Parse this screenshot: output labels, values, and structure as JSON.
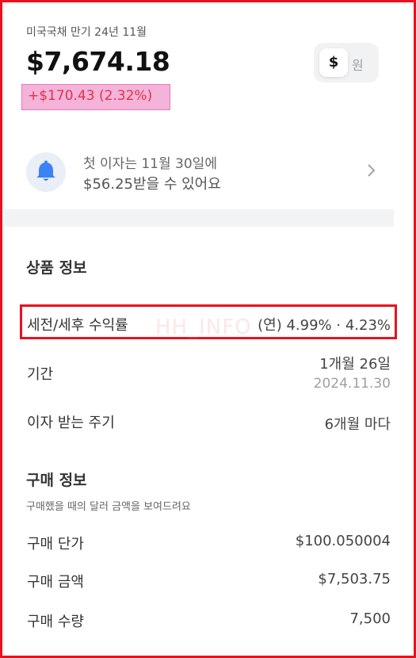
{
  "header": {
    "subtitle": "미국국채 만기 24년 11월",
    "price": "$7,674.18",
    "change": "+$170.43 (2.32%)",
    "currency_toggle": {
      "dollar_label": "$",
      "won_label": "원"
    }
  },
  "notice": {
    "line1": "첫 이자는 11월 30일에",
    "line2": "$56.25받을 수 있어요"
  },
  "product_info": {
    "title": "상품 정보",
    "rows": [
      {
        "label": "세전/세후 수익률",
        "value": "(연) 4.99% · 4.23%"
      },
      {
        "label": "기간",
        "value": "1개월 26일",
        "sub_value": "2024.11.30"
      },
      {
        "label": "이자 받는 주기",
        "value": "6개월 마다"
      }
    ]
  },
  "purchase_info": {
    "title": "구매 정보",
    "caption": "구매했을 때의 달러 금액을 보여드려요",
    "rows": [
      {
        "label": "구매 단가",
        "value": "$100.050004"
      },
      {
        "label": "구매 금액",
        "value": "$7,503.75"
      },
      {
        "label": "구매 수량",
        "value": "7,500"
      }
    ]
  },
  "watermark": "HH_INFO",
  "colors": {
    "highlight_red": "#e8121e",
    "change_red": "#e0324a",
    "pink_highlight": "#f4b3d8",
    "bell_blue": "#3b82f6"
  }
}
